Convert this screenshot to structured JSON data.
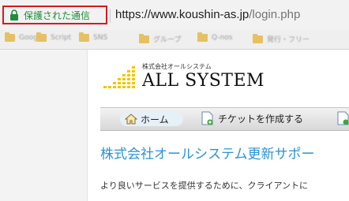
{
  "address_bar": {
    "security_label": "保護された通信",
    "url_host": "https://www.koushin-as.jp",
    "url_path": "/login.php"
  },
  "bookmarks": [
    {
      "label": "Google",
      "icon": "folder-icon"
    },
    {
      "label": "Script",
      "icon": "folder-icon"
    },
    {
      "label": "SNS",
      "icon": "folder-icon"
    },
    {
      "label": "グループ",
      "icon": "folder-icon"
    },
    {
      "label": "Q-nos",
      "icon": "folder-icon"
    },
    {
      "label": "発行・フリー",
      "icon": "folder-icon"
    }
  ],
  "logo": {
    "company_small": "株式会社オールシステム",
    "brand": "ALL SYSTEM"
  },
  "nav": {
    "home": "ホーム",
    "create_ticket": "チケットを作成する"
  },
  "content": {
    "title": "株式会社オールシステム更新サポー",
    "description": "より良いサービスを提供するために、クライアントに"
  },
  "colors": {
    "secure_green": "#1e8e3e",
    "highlight_red": "#d9191f",
    "title_blue": "#2a93d5",
    "logo_yellow": "#f2c400"
  }
}
